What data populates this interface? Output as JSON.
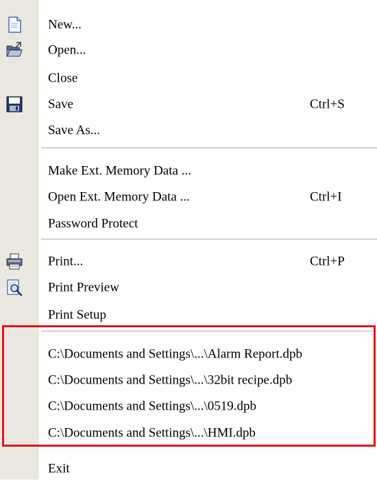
{
  "menu": {
    "items": [
      {
        "label": "New...",
        "shortcut": "",
        "icon": "new-document-icon"
      },
      {
        "label": "Open...",
        "shortcut": "",
        "icon": "open-folder-icon"
      },
      {
        "label": "Close",
        "shortcut": "",
        "icon": ""
      },
      {
        "label": "Save",
        "shortcut": "Ctrl+S",
        "icon": "save-disk-icon"
      },
      {
        "label": "Save As...",
        "shortcut": "",
        "icon": ""
      },
      {
        "label": "Make Ext. Memory Data ...",
        "shortcut": "",
        "icon": ""
      },
      {
        "label": "Open Ext. Memory Data ...",
        "shortcut": "Ctrl+I",
        "icon": ""
      },
      {
        "label": "Password Protect",
        "shortcut": "",
        "icon": ""
      },
      {
        "label": "Print...",
        "shortcut": "Ctrl+P",
        "icon": "printer-icon"
      },
      {
        "label": "Print Preview",
        "shortcut": "",
        "icon": "print-preview-icon"
      },
      {
        "label": "Print Setup",
        "shortcut": "",
        "icon": ""
      }
    ],
    "recent_files": [
      "C:\\Documents and Settings\\...\\Alarm Report.dpb",
      "C:\\Documents and Settings\\...\\32bit recipe.dpb",
      "C:\\Documents and Settings\\...\\0519.dpb",
      "C:\\Documents and Settings\\...\\HMI.dpb"
    ],
    "exit_label": "Exit"
  },
  "colors": {
    "gutter": "#eae8e1",
    "separator": "#a9a9a9",
    "highlight_box": "#e3141b"
  }
}
